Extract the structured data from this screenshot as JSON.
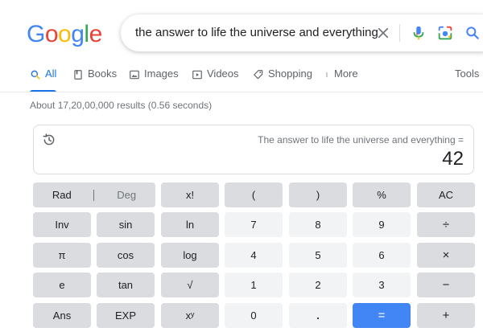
{
  "logo": {
    "letters": [
      "G",
      "o",
      "o",
      "g",
      "l",
      "e"
    ],
    "colors": [
      "#4285f4",
      "#ea4335",
      "#fbbc05",
      "#4285f4",
      "#34a853",
      "#ea4335"
    ]
  },
  "search": {
    "query": "the answer to life the universe and everything"
  },
  "tabs": [
    {
      "label": "All",
      "icon": "search-icon",
      "active": true
    },
    {
      "label": "Books",
      "icon": "book-icon"
    },
    {
      "label": "Images",
      "icon": "image-icon"
    },
    {
      "label": "Videos",
      "icon": "play-icon"
    },
    {
      "label": "Shopping",
      "icon": "tag-icon"
    },
    {
      "label": "More",
      "icon": "more-vert-icon"
    },
    {
      "label": "Tools"
    }
  ],
  "result_stats": "About 17,20,00,000 results (0.56 seconds)",
  "calculator": {
    "expression": "The answer to life the universe and everything =",
    "result": "42",
    "keys": {
      "rad": "Rad",
      "deg": "Deg",
      "fact": "x!",
      "lparen": "(",
      "rparen": ")",
      "percent": "%",
      "ac": "AC",
      "inv": "Inv",
      "sin": "sin",
      "ln": "ln",
      "seven": "7",
      "eight": "8",
      "nine": "9",
      "divide": "÷",
      "pi": "π",
      "cos": "cos",
      "log": "log",
      "four": "4",
      "five": "5",
      "six": "6",
      "multiply": "×",
      "e": "e",
      "tan": "tan",
      "sqrt": "√",
      "one": "1",
      "two": "2",
      "three": "3",
      "minus": "−",
      "ans": "Ans",
      "exp": "EXP",
      "power": "xʸ",
      "zero": "0",
      "dot": ".",
      "equals": "=",
      "plus": "+"
    }
  },
  "colors": {
    "accent": "#1a73e8",
    "equals_key": "#4285f4",
    "function_key": "#dadce0",
    "number_key": "#f1f3f4"
  }
}
